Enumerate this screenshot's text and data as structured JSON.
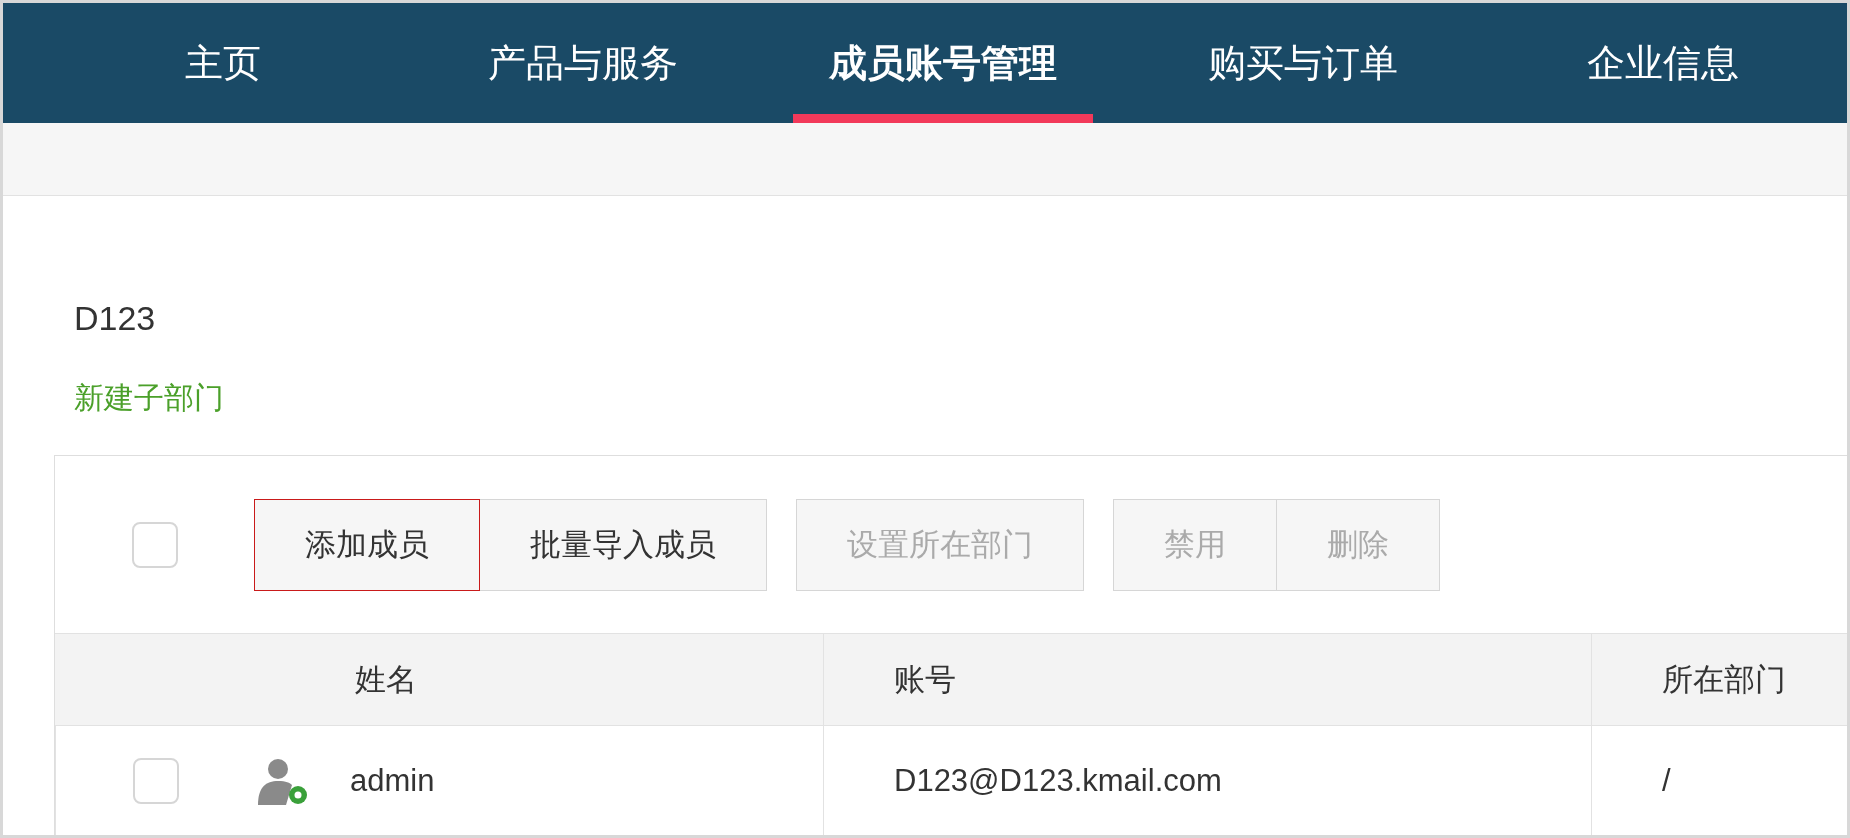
{
  "nav": {
    "tabs": [
      {
        "label": "主页",
        "selected": false
      },
      {
        "label": "产品与服务",
        "selected": false
      },
      {
        "label": "成员账号管理",
        "selected": true
      },
      {
        "label": "购买与订单",
        "selected": false
      },
      {
        "label": "企业信息",
        "selected": false
      }
    ]
  },
  "department": {
    "name": "D123",
    "new_sub_link": "新建子部门"
  },
  "toolbar": {
    "select_all": {
      "checked": false
    },
    "button_groups": [
      [
        {
          "label": "添加成员",
          "selected": true,
          "disabled": false
        },
        {
          "label": "批量导入成员",
          "selected": false,
          "disabled": false
        }
      ],
      [
        {
          "label": "设置所在部门",
          "selected": false,
          "disabled": true
        }
      ],
      [
        {
          "label": "禁用",
          "selected": false,
          "disabled": true
        },
        {
          "label": "删除",
          "selected": false,
          "disabled": true
        }
      ]
    ]
  },
  "table": {
    "columns": [
      "姓名",
      "账号",
      "所在部门"
    ],
    "rows": [
      {
        "checked": false,
        "name": "admin",
        "account": "D123@D123.kmail.com",
        "department": "/"
      }
    ]
  }
}
